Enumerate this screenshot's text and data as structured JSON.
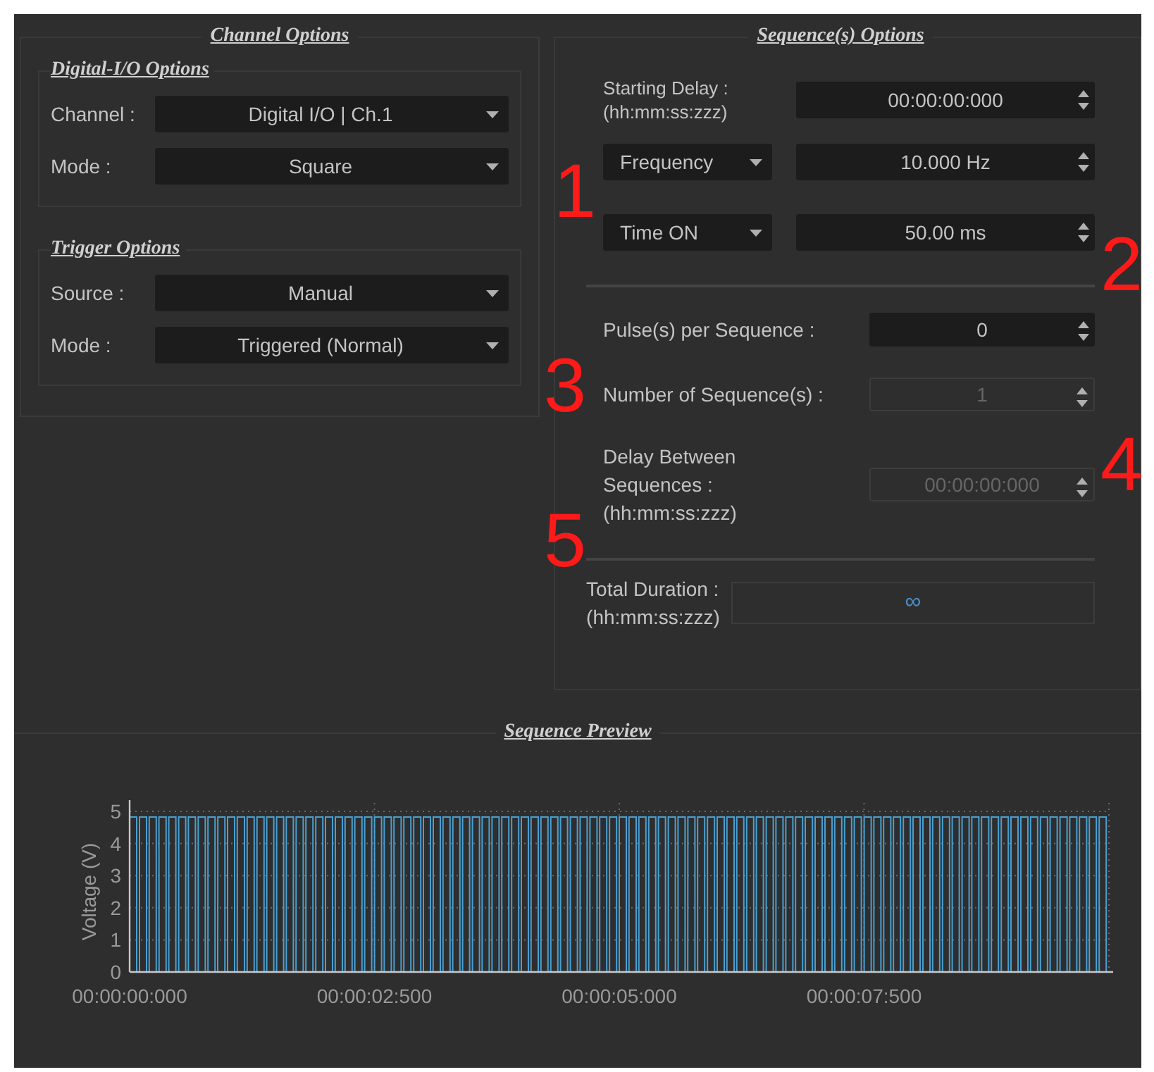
{
  "channel_options": {
    "title": "Channel Options",
    "groups": [
      {
        "title": "Digital-I/O Options",
        "rows": [
          {
            "label": "Channel :",
            "value": "Digital I/O | Ch.1"
          },
          {
            "label": "Mode :",
            "value": "Square"
          }
        ]
      },
      {
        "title": "Trigger Options",
        "rows": [
          {
            "label": "Source :",
            "value": "Manual"
          },
          {
            "label": "Mode :",
            "value": "Triggered (Normal)"
          }
        ]
      }
    ]
  },
  "sequence_options": {
    "title": "Sequence(s) Options",
    "starting_delay": {
      "label_lines": [
        "Starting Delay :",
        "(hh:mm:ss:zzz)"
      ],
      "value": "00:00:00:000"
    },
    "parameters": [
      {
        "select": "Frequency",
        "value": "10.000 Hz"
      },
      {
        "select": "Time ON",
        "value": "50.00 ms"
      }
    ],
    "counts": [
      {
        "label_lines": [
          "Pulse(s) per Sequence :"
        ],
        "value": "0",
        "disabled": false
      },
      {
        "label_lines": [
          "Number of Sequence(s) :"
        ],
        "value": "1",
        "disabled": true
      },
      {
        "label_lines": [
          "Delay Between",
          "Sequences :",
          "(hh:mm:ss:zzz)"
        ],
        "value": "00:00:00:000",
        "disabled": true
      }
    ],
    "total_duration": {
      "label_lines": [
        "Total Duration :",
        "(hh:mm:ss:zzz)"
      ],
      "value": "∞"
    }
  },
  "sequence_preview": {
    "title": "Sequence Preview",
    "ylabel": "Voltage (V)",
    "y_ticks": [
      "5",
      "4",
      "3",
      "2",
      "1",
      "0"
    ],
    "x_ticks": [
      "00:00:00:000",
      "00:00:02:500",
      "00:00:05:000",
      "00:00:07:500"
    ]
  },
  "annotations": [
    "1",
    "2",
    "3",
    "4",
    "5"
  ]
}
